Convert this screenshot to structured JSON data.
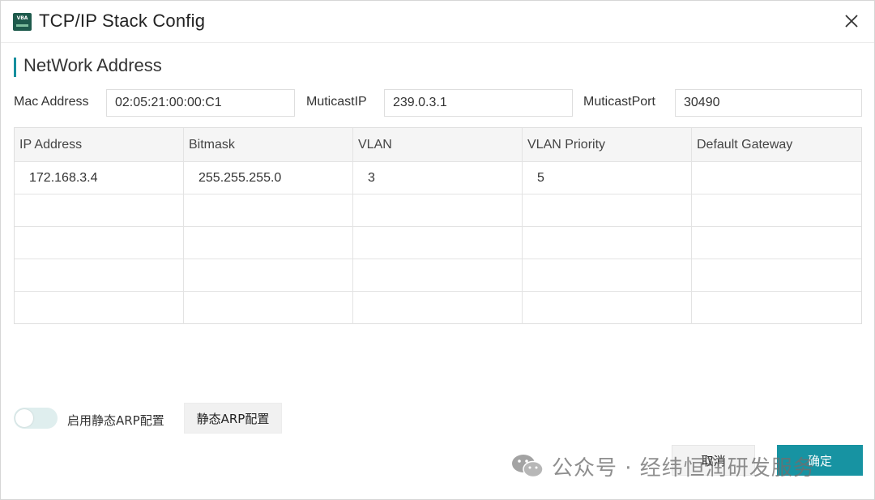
{
  "window": {
    "title": "TCP/IP Stack Config",
    "app_icon_text": "VBA",
    "close_icon": "close-icon"
  },
  "section": {
    "title": "NetWork Address",
    "accent_color": "#168f9e"
  },
  "fields": {
    "mac_label": "Mac Address",
    "mac_value": "02:05:21:00:00:C1",
    "mcast_ip_label": "MuticastIP",
    "mcast_ip_value": "239.0.3.1",
    "mcast_port_label": "MuticastPort",
    "mcast_port_value": "30490"
  },
  "table": {
    "columns": [
      "IP Address",
      "Bitmask",
      "VLAN",
      "VLAN Priority",
      "Default Gateway"
    ],
    "rows": [
      [
        "172.168.3.4",
        "255.255.255.0",
        "3",
        "5",
        ""
      ],
      [
        "",
        "",
        "",
        "",
        ""
      ],
      [
        "",
        "",
        "",
        "",
        ""
      ],
      [
        "",
        "",
        "",
        "",
        ""
      ],
      [
        "",
        "",
        "",
        "",
        ""
      ]
    ]
  },
  "arp": {
    "toggle_label": "启用静态ARP配置",
    "toggle_on": false,
    "button_label": "静态ARP配置"
  },
  "buttons": {
    "cancel": "取消",
    "ok": "确定",
    "ok_color": "#1793a2"
  },
  "watermark": {
    "text": "公众号 · 经纬恒润研发服务",
    "icon": "wechat-icon"
  }
}
